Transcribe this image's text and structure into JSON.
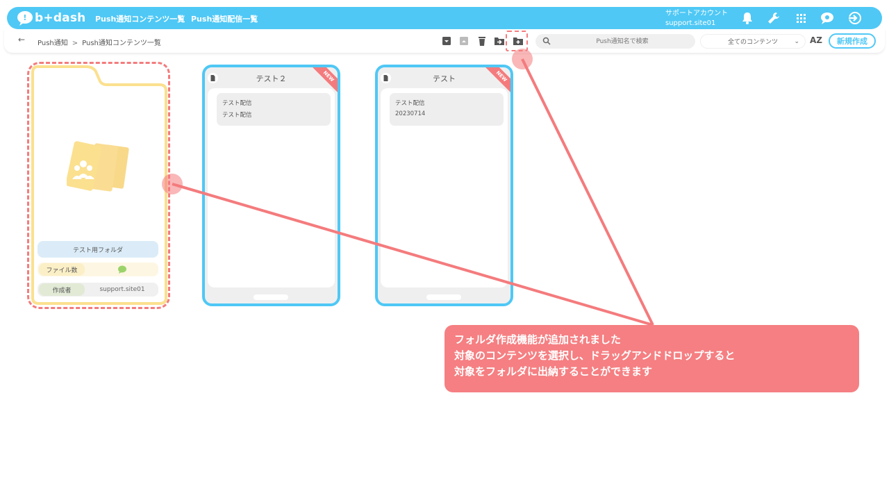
{
  "app": {
    "logo_text": "b+dash",
    "brand_color": "#4fc8f5",
    "accent_color": "#f47b7d"
  },
  "header": {
    "nav": [
      "Push通知コンテンツ一覧",
      "Push通知配信一覧"
    ],
    "account_label": "サポートアカウント",
    "account_id": "support.site01",
    "icons": [
      "bell-icon",
      "wrench-icon",
      "grid-apps-icon",
      "chat-bubble-icon",
      "logout-icon"
    ]
  },
  "toolbar": {
    "back_glyph": "←",
    "breadcrumb": [
      "Push通知",
      "Push通知コンテンツ一覧"
    ],
    "breadcrumb_sep": ">",
    "action_icons": [
      "archive-icon",
      "unarchive-icon",
      "trash-icon",
      "move-to-folder-icon",
      "new-folder-icon"
    ],
    "search_placeholder": "Push通知名で検索",
    "filter_selected": "全てのコンテンツ",
    "sort_label": "AZ",
    "new_button": "新規作成"
  },
  "folder": {
    "name": "テスト用フォルダ",
    "file_count_label": "ファイル数",
    "file_count_color": "#9bd36a",
    "creator_label": "作成者",
    "creator_value": "support.site01"
  },
  "cards": [
    {
      "title": "テスト２",
      "badge": "NEW",
      "message_title": "テスト配信",
      "message_body": "テスト配信"
    },
    {
      "title": "テスト",
      "badge": "NEW",
      "message_title": "テスト配信",
      "message_body": "20230714"
    }
  ],
  "annotation": {
    "lines": [
      "フォルダ作成機能が追加されました",
      "対象のコンテンツを選択し、ドラッグアンドドロップすると",
      "対象をフォルダに出納することができます"
    ]
  }
}
